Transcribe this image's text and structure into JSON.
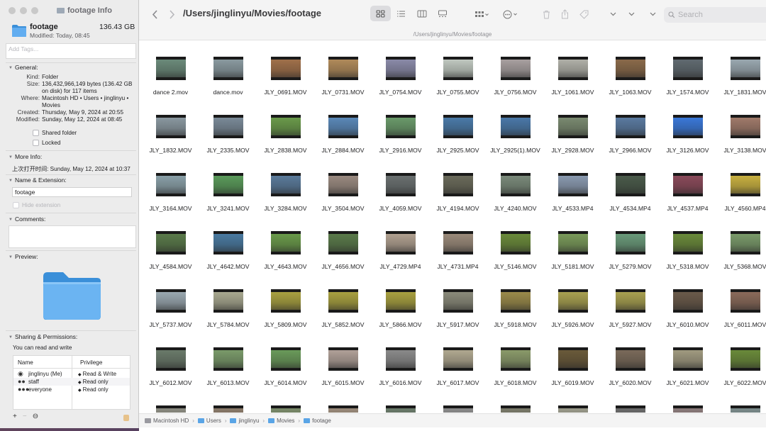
{
  "info": {
    "window_title": "footage Info",
    "name": "footage",
    "size": "136.43 GB",
    "modified_short": "Modified: Today, 08:45",
    "tags_placeholder": "Add Tags...",
    "general": {
      "heading": "General:",
      "rows": [
        {
          "k": "Kind:",
          "v": "Folder"
        },
        {
          "k": "Size:",
          "v": "136,432,966,149 bytes (136.42 GB on disk) for 117 items"
        },
        {
          "k": "Where:",
          "v": "Macintosh HD • Users • jinglinyu • Movies"
        },
        {
          "k": "Created:",
          "v": "Thursday, May 9, 2024 at 20:55"
        },
        {
          "k": "Modified:",
          "v": "Sunday, May 12, 2024 at 08:45"
        }
      ],
      "shared_folder": "Shared folder",
      "locked": "Locked"
    },
    "more_info": {
      "heading": "More Info:",
      "last_opened": "上次打开时间: Sunday, May 12, 2024 at 10:37"
    },
    "name_ext": {
      "heading": "Name & Extension:",
      "value": "footage",
      "hide_extension": "Hide extension"
    },
    "comments": {
      "heading": "Comments:"
    },
    "preview": {
      "heading": "Preview:"
    },
    "sharing": {
      "heading": "Sharing & Permissions:",
      "summary": "You can read and write",
      "col_name": "Name",
      "col_privilege": "Privilege",
      "rows": [
        {
          "name": "jinglinyu (Me)",
          "privilege": "Read & Write",
          "icon": "person-icon"
        },
        {
          "name": "staff",
          "privilege": "Read only",
          "icon": "group-icon"
        },
        {
          "name": "everyone",
          "privilege": "Read only",
          "icon": "group-icon"
        }
      ]
    },
    "foot": {
      "add": "+",
      "remove": "−",
      "more": "⊖"
    }
  },
  "finder": {
    "title": "/Users/jinglinyu/Movies/footage",
    "path_label": "/Users/jinglinyu/Movies/footage",
    "search_placeholder": "Search",
    "breadcrumbs": [
      "Macintosh HD",
      "Users",
      "jinglinyu",
      "Movies",
      "footage"
    ],
    "files": [
      "dance 2.mov",
      "dance.mov",
      "JLY_0691.MOV",
      "JLY_0731.MOV",
      "JLY_0754.MOV",
      "JLY_0755.MOV",
      "JLY_0756.MOV",
      "JLY_1061.MOV",
      "JLY_1063.MOV",
      "JLY_1574.MOV",
      "JLY_1831.MOV",
      "JLY_1832.MOV",
      "JLY_2335.MOV",
      "JLY_2838.MOV",
      "JLY_2884.MOV",
      "JLY_2916.MOV",
      "JLY_2925.MOV",
      "JLY_2925(1).MOV",
      "JLY_2928.MOV",
      "JLY_2966.MOV",
      "JLY_3126.MOV",
      "JLY_3138.MOV",
      "JLY_3164.MOV",
      "JLY_3241.MOV",
      "JLY_3284.MOV",
      "JLY_3504.MOV",
      "JLY_4059.MOV",
      "JLY_4194.MOV",
      "JLY_4240.MOV",
      "JLY_4533.MP4",
      "JLY_4534.MP4",
      "JLY_4537.MP4",
      "JLY_4560.MP4",
      "JLY_4584.MOV",
      "JLY_4642.MOV",
      "JLY_4643.MOV",
      "JLY_4656.MOV",
      "JLY_4729.MP4",
      "JLY_4731.MP4",
      "JLY_5146.MOV",
      "JLY_5181.MOV",
      "JLY_5279.MOV",
      "JLY_5318.MOV",
      "JLY_5368.MOV",
      "JLY_5737.MOV",
      "JLY_5784.MOV",
      "JLY_5809.MOV",
      "JLY_5852.MOV",
      "JLY_5866.MOV",
      "JLY_5917.MOV",
      "JLY_5918.MOV",
      "JLY_5926.MOV",
      "JLY_5927.MOV",
      "JLY_6010.MOV",
      "JLY_6011.MOV",
      "JLY_6012.MOV",
      "JLY_6013.MOV",
      "JLY_6014.MOV",
      "JLY_6015.MOV",
      "JLY_6016.MOV",
      "JLY_6017.MOV",
      "JLY_6018.MOV",
      "JLY_6019.MOV",
      "JLY_6020.MOV",
      "JLY_6021.MOV",
      "JLY_6022.MOV"
    ],
    "partial_row_count": 11,
    "thumb_colors": [
      "#6b8a7a",
      "#8a9aa0",
      "#a0704a",
      "#b08a5a",
      "#8a8aa8",
      "#c0c8c0",
      "#a8a0a0",
      "#b0b0a8",
      "#8a6a4a",
      "#606a70",
      "#9aa8b0",
      "#8a98a0",
      "#7a8a98",
      "#6a9a4a",
      "#5a88b8",
      "#6a9a6a",
      "#4a7aa8",
      "#4a78a8",
      "#7a8a70",
      "#5a7aa0",
      "#3a78d8",
      "#a07a6a",
      "#8aa0a8",
      "#5a9a5a",
      "#5a7a9a",
      "#9a8a80",
      "#6a7070",
      "#6a6a5a",
      "#7a8a7a",
      "#8a9ab0",
      "#4a5a4a",
      "#8a4a5a",
      "#c8b040",
      "#5a7a4a",
      "#4a7aa0",
      "#6a9a4a",
      "#5a7a4a",
      "#b0a090",
      "#9a8a7a",
      "#6a8a3a",
      "#7a9a5a",
      "#6a9a7a",
      "#6a8a3a",
      "#7a9a6a",
      "#9aa8b0",
      "#a8a890",
      "#a8a040",
      "#a8a040",
      "#a8a040",
      "#8a8a7a",
      "#9a8a4a",
      "#a8a050",
      "#a8a050",
      "#6a5a4a",
      "#8a6a5a",
      "#6a7a6a",
      "#7a9a6a",
      "#6a9a5a",
      "#b0a098",
      "#8a8a8a",
      "#b0a890",
      "#8a9a6a",
      "#6a5a3a",
      "#7a6a5a",
      "#a09a80",
      "#6a8a3a",
      "#8a8a80",
      "#8a7a6a",
      "#7a8a6a",
      "#9a8a7a",
      "#6a7a6a",
      "#8a8a8a",
      "#7a7a6a",
      "#9a9a8a",
      "#6a6a6a",
      "#8a7a7a",
      "#7a8a8a"
    ]
  }
}
